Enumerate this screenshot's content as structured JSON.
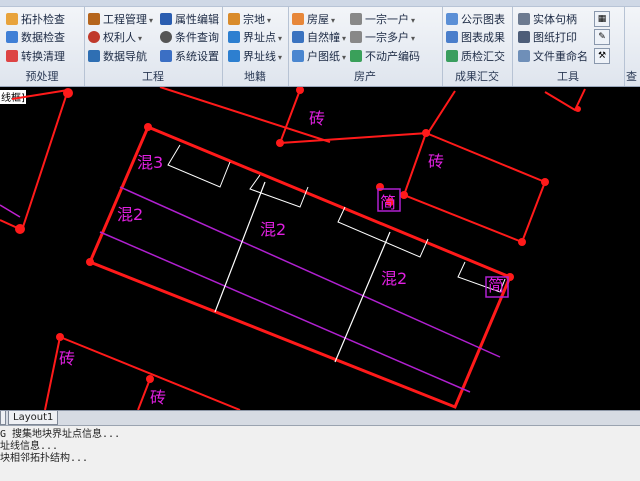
{
  "ribbon": {
    "groups": [
      {
        "label": "预处理",
        "buttons": [
          "拓扑检查",
          "数据检查",
          "转换清理"
        ]
      },
      {
        "label": "工程",
        "buttons": [
          "工程管理",
          "权利人",
          "数据导航",
          "属性编辑",
          "条件查询",
          "系统设置"
        ]
      },
      {
        "label": "地籍",
        "buttons": [
          "宗地",
          "界址点",
          "界址线"
        ]
      },
      {
        "label": "房产",
        "buttons": [
          "房屋",
          "自然幢",
          "户图纸",
          "一宗一户",
          "一宗多户",
          "不动产编码"
        ]
      },
      {
        "label": "成果汇交",
        "buttons": [
          "公示图表",
          "图表成果",
          "质检汇交"
        ]
      },
      {
        "label": "工具",
        "buttons": [
          "实体句柄",
          "图纸打印",
          "文件重命名"
        ]
      },
      {
        "label": "查"
      }
    ]
  },
  "canvas": {
    "viewport_label": "线框]",
    "labels": [
      "砖",
      "砖",
      "混3",
      "混2",
      "混2",
      "混2",
      "简",
      "简",
      "砖",
      "砖"
    ]
  },
  "tabs": {
    "layout": "Layout1"
  },
  "command_lines": [
    "G 搜集地块界址点信息...",
    "址线信息...",
    "块相邻拓扑结构..."
  ]
}
